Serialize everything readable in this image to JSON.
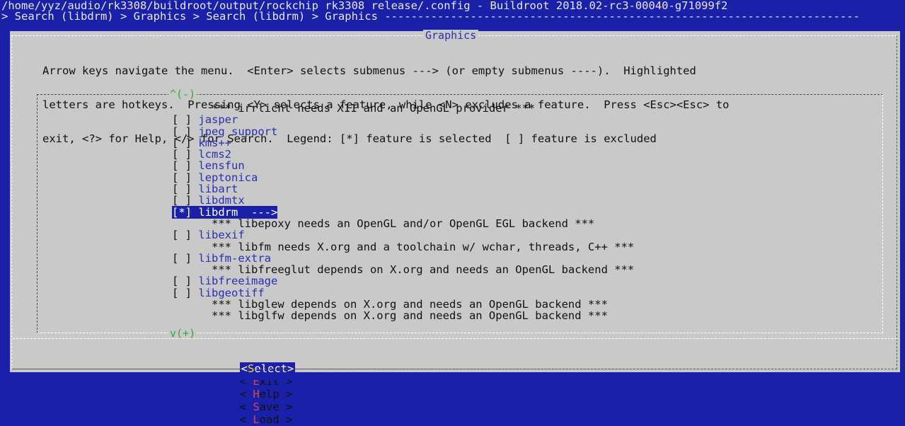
{
  "header": {
    "title": "/home/yyz/audio/rk3308/buildroot/output/rockchip_rk3308_release/.config - Buildroot 2018.02-rc3-00040-g71099f2",
    "breadcrumb": "> Search (libdrm) > Graphics > Search (libdrm) > Graphics ------------------------------------------------------------------------"
  },
  "dialog": {
    "title": "Graphics",
    "help_lines": [
      "Arrow keys navigate the menu.  <Enter> selects submenus ---> (or empty submenus ----).  Highlighted",
      "letters are hotkeys.  Pressing <Y> selects a feature, while <N> excludes a feature.  Press <Esc><Esc> to",
      "exit, <?> for Help, </> for Search.  Legend: [*] feature is selected  [ ] feature is excluded"
    ],
    "scroll_up": "^(-)",
    "scroll_down": "v(+)"
  },
  "menu": {
    "items": [
      {
        "type": "comment",
        "text": "*** irrlicht needs X11 and an OpenGL provider ***"
      },
      {
        "type": "option",
        "box": "[ ]",
        "hotkey": "j",
        "rest": "asper"
      },
      {
        "type": "option",
        "box": "[ ]",
        "hotkey": "j",
        "rest": "peg support"
      },
      {
        "type": "option",
        "box": "[ ]",
        "hotkey": "k",
        "rest": "ms++"
      },
      {
        "type": "option",
        "box": "[ ]",
        "hotkey": "l",
        "rest": "cms2"
      },
      {
        "type": "option",
        "box": "[ ]",
        "hotkey": "l",
        "rest": "ensfun"
      },
      {
        "type": "option",
        "box": "[ ]",
        "hotkey": "l",
        "rest": "eptonica"
      },
      {
        "type": "option",
        "box": "[ ]",
        "hotkey": "l",
        "rest": "ibart"
      },
      {
        "type": "option",
        "box": "[ ]",
        "hotkey": "l",
        "rest": "ibdmtx"
      },
      {
        "type": "selected",
        "box": "[*]",
        "label": "libdrm  --->"
      },
      {
        "type": "comment",
        "text": "*** libepoxy needs an OpenGL and/or OpenGL EGL backend ***"
      },
      {
        "type": "option",
        "box": "[ ]",
        "hotkey": "l",
        "rest": "ibexif"
      },
      {
        "type": "comment",
        "text": "*** libfm needs X.org and a toolchain w/ wchar, threads, C++ ***"
      },
      {
        "type": "option",
        "box": "[ ]",
        "hotkey": "l",
        "rest": "ibfm-extra"
      },
      {
        "type": "comment",
        "text": "*** libfreeglut depends on X.org and needs an OpenGL backend ***"
      },
      {
        "type": "option",
        "box": "[ ]",
        "hotkey": "l",
        "rest": "ibfreeimage"
      },
      {
        "type": "option",
        "box": "[ ]",
        "hotkey": "l",
        "rest": "ibgeotiff"
      },
      {
        "type": "comment",
        "text": "*** libglew depends on X.org and needs an OpenGL backend ***"
      },
      {
        "type": "comment",
        "text": "*** libglfw depends on X.org and needs an OpenGL backend ***"
      }
    ]
  },
  "buttons": {
    "select": {
      "pre": "<",
      "hk": "S",
      "post": "elect>"
    },
    "exit": {
      "pre": "< ",
      "hk": "E",
      "post": "xit >"
    },
    "help": {
      "pre": "< ",
      "hk": "H",
      "post": "elp >"
    },
    "save": {
      "pre": "< ",
      "hk": "S",
      "post": "ave >"
    },
    "load": {
      "pre": "< ",
      "hk": "L",
      "post": "oad >"
    }
  },
  "colors": {
    "background": "#1a20a8",
    "dialog": "#c9c9c9",
    "hotkey": "#2a2fb0",
    "button_hotkey": "#d24848",
    "scroll_indicator": "#2fae2f"
  }
}
